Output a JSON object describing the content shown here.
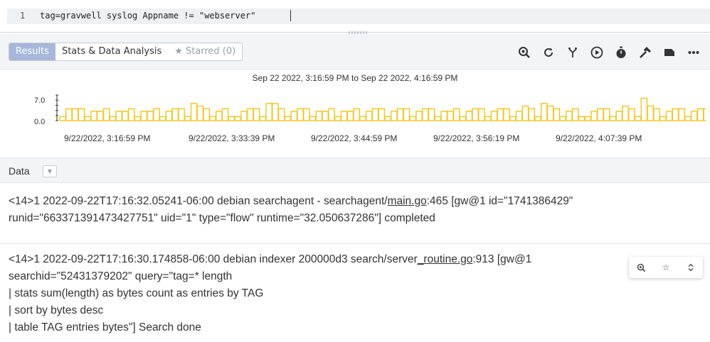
{
  "editor": {
    "line_number": "1",
    "query": "tag=gravwell syslog Appname != \"webserver\""
  },
  "tabs": [
    {
      "label": "Results",
      "active": true
    },
    {
      "label": "Stats & Data Analysis",
      "active": false
    },
    {
      "label": "Starred (0)",
      "active": false
    }
  ],
  "toolbar_icons": [
    "overview-search-icon",
    "refresh-icon",
    "fork-icon",
    "play-icon",
    "timer-icon",
    "hammer-icon",
    "label-icon",
    "more-icon"
  ],
  "chart_data": {
    "type": "bar",
    "title": "Sep 22 2022, 3:16:59 PM to Sep 22 2022, 4:16:59 PM",
    "y_ticks": [
      "7.0",
      "0.0"
    ],
    "ylim": [
      0,
      7
    ],
    "x_ticks": [
      "9/22/2022, 3:16:59 PM",
      "9/22/2022, 3:33:39 PM",
      "9/22/2022, 3:44:59 PM",
      "9/22/2022, 3:56:19 PM",
      "9/22/2022, 4:07:39 PM"
    ],
    "color": "#f5c518",
    "values": [
      1,
      4,
      4,
      4,
      1,
      3,
      3,
      4,
      1,
      3,
      3,
      4,
      1,
      3,
      3,
      4,
      1,
      3,
      4,
      4,
      1,
      6,
      5,
      4,
      1,
      3,
      4,
      1,
      1,
      3,
      4,
      4,
      1,
      6,
      6,
      4,
      1,
      3,
      4,
      4,
      1,
      3,
      3,
      4,
      1,
      3,
      3,
      4,
      1,
      3,
      4,
      4,
      1,
      3,
      4,
      4,
      1,
      3,
      4,
      4,
      1,
      3,
      3,
      4,
      1,
      3,
      4,
      4,
      1,
      3,
      4,
      4,
      1,
      3,
      5,
      4,
      1,
      6,
      5,
      4,
      1,
      3,
      4,
      1,
      1,
      3,
      4,
      4,
      1,
      3,
      5,
      4,
      1,
      8,
      5,
      4,
      1,
      3,
      4,
      4,
      1,
      3,
      4,
      4
    ]
  },
  "data_section": {
    "label": "Data",
    "dropdown_icon": "chevron-down-icon"
  },
  "entries": [
    {
      "pre": "<14>1 2022-09-22T17:16:32.05241-06:00 debian searchagent - searchagent/",
      "link": "main.go",
      "post": ":465 [gw@1 id=\"1741386429\"",
      "line2": "runid=\"663371391473427751\" uid=\"1\" type=\"flow\" runtime=\"32.050637286\"] completed"
    },
    {
      "pre": "<14>1 2022-09-22T17:16:30.174858-06:00 debian indexer 200000d3 search/server",
      "link": "_routine.go",
      "post": ":913 [gw@1",
      "line2": "searchid=\"52431379202\" query=\"tag=* length",
      "line3": "| stats sum(length) as bytes count as entries by TAG",
      "line4": "| sort by bytes desc",
      "line5": "| table TAG entries bytes\"] Search done"
    }
  ],
  "row_actions": [
    "overview-search-icon",
    "star-icon",
    "expand-icon"
  ]
}
